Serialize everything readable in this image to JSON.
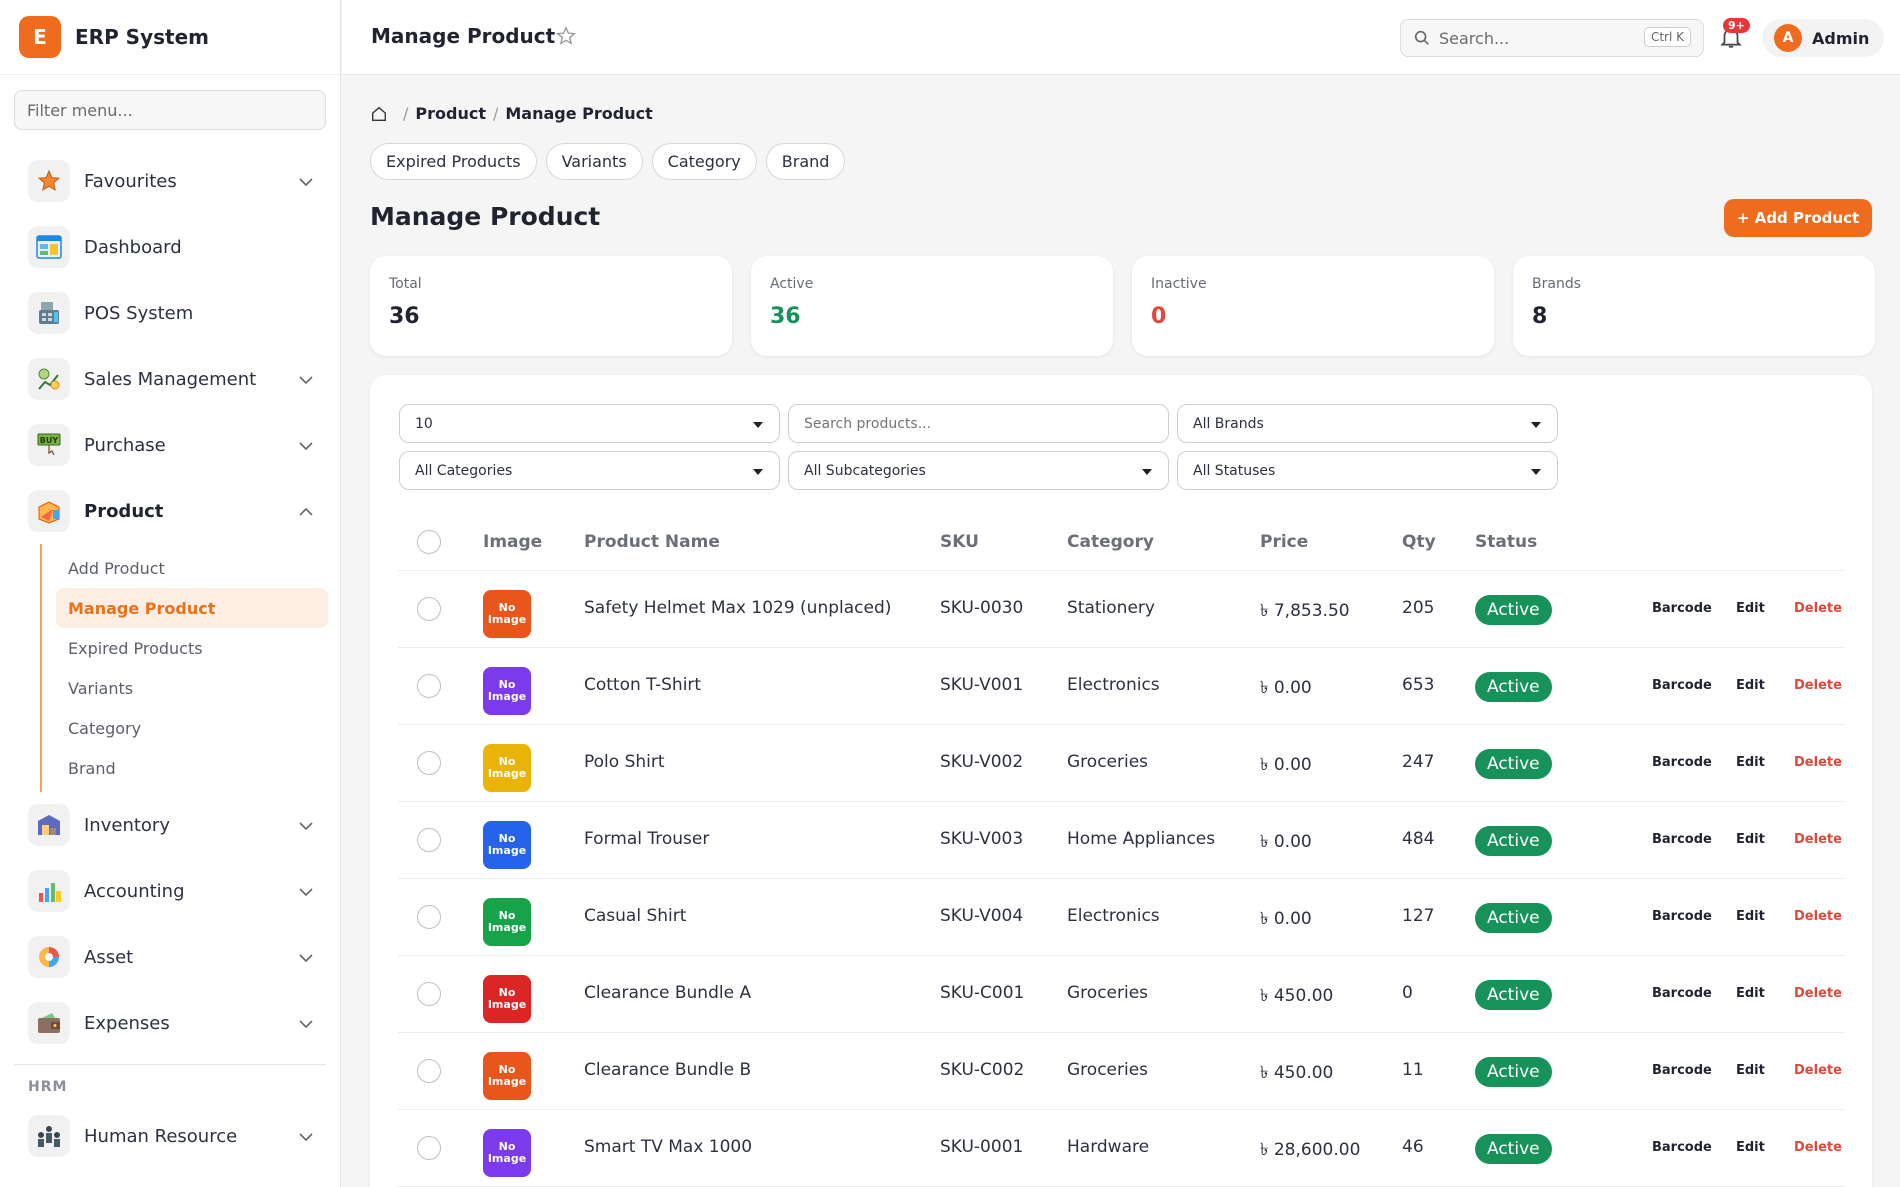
{
  "sidebar": {
    "brand_initial": "E",
    "brand_name": "ERP System",
    "filter_placeholder": "Filter menu...",
    "items_top": [
      {
        "label": "Favourites",
        "icon": "star-icon"
      },
      {
        "label": "Dashboard",
        "icon": "dashboard-icon"
      },
      {
        "label": "POS System",
        "icon": "pos-icon"
      },
      {
        "label": "Sales Management",
        "icon": "sales-icon"
      },
      {
        "label": "Purchase",
        "icon": "purchase-icon"
      },
      {
        "label": "Product",
        "icon": "product-icon"
      }
    ],
    "purchase_icon_text": "BUY",
    "product_submenu": [
      "Add Product",
      "Manage Product",
      "Expired Products",
      "Variants",
      "Category",
      "Brand"
    ],
    "items_bottom": [
      {
        "label": "Inventory",
        "icon": "inventory-icon"
      },
      {
        "label": "Accounting",
        "icon": "accounting-icon"
      },
      {
        "label": "Asset",
        "icon": "asset-icon"
      },
      {
        "label": "Expenses",
        "icon": "expenses-icon"
      }
    ],
    "section_hrm": "HRM",
    "hrm_item": "Human Resource"
  },
  "topbar": {
    "title": "Manage Product",
    "search_placeholder": "Search...",
    "shortcut": "Ctrl K",
    "notifications_badge": "9+",
    "user_initial": "A",
    "user_name": "Admin"
  },
  "breadcrumb": {
    "level1": "Product",
    "level2": "Manage Product",
    "separator": "/"
  },
  "quick_links": [
    "Expired Products",
    "Variants",
    "Category",
    "Brand"
  ],
  "page_title": "Manage Product",
  "add_button": "+ Add Product",
  "stats": [
    {
      "label": "Total",
      "value": "36",
      "color": "#1f2430"
    },
    {
      "label": "Active",
      "value": "36",
      "color": "#17925a"
    },
    {
      "label": "Inactive",
      "value": "0",
      "color": "#e0483b"
    },
    {
      "label": "Brands",
      "value": "8",
      "color": "#1f2430"
    }
  ],
  "filters": {
    "page_size": "10",
    "search_placeholder": "Search products...",
    "brand": "All Brands",
    "category": "All Categories",
    "subcategory": "All Subcategories",
    "status": "All Statuses"
  },
  "table": {
    "columns": [
      "Image",
      "Product Name",
      "SKU",
      "Category",
      "Price",
      "Qty",
      "Status"
    ],
    "no_image_text": "No Image",
    "action_labels": [
      "Barcode",
      "Edit",
      "Delete"
    ],
    "rows": [
      {
        "name": "Safety Helmet Max 1029 (unplaced)",
        "sku": "SKU-0030",
        "category": "Stationery",
        "price": "৳ 7,853.50",
        "qty": "205",
        "status": "Active",
        "img_color": "#e8561b"
      },
      {
        "name": "Cotton T-Shirt",
        "sku": "SKU-V001",
        "category": "Electronics",
        "price": "৳ 0.00",
        "qty": "653",
        "status": "Active",
        "img_color": "#7c3aed"
      },
      {
        "name": "Polo Shirt",
        "sku": "SKU-V002",
        "category": "Groceries",
        "price": "৳ 0.00",
        "qty": "247",
        "status": "Active",
        "img_color": "#eab308"
      },
      {
        "name": "Formal Trouser",
        "sku": "SKU-V003",
        "category": "Home Appliances",
        "price": "৳ 0.00",
        "qty": "484",
        "status": "Active",
        "img_color": "#2563eb"
      },
      {
        "name": "Casual Shirt",
        "sku": "SKU-V004",
        "category": "Electronics",
        "price": "৳ 0.00",
        "qty": "127",
        "status": "Active",
        "img_color": "#16a34a"
      },
      {
        "name": "Clearance Bundle A",
        "sku": "SKU-C001",
        "category": "Groceries",
        "price": "৳ 450.00",
        "qty": "0",
        "status": "Active",
        "img_color": "#dc2626"
      },
      {
        "name": "Clearance Bundle B",
        "sku": "SKU-C002",
        "category": "Groceries",
        "price": "৳ 450.00",
        "qty": "11",
        "status": "Active",
        "img_color": "#e8561b"
      },
      {
        "name": "Smart TV Max 1000",
        "sku": "SKU-0001",
        "category": "Hardware",
        "price": "৳ 28,600.00",
        "qty": "46",
        "status": "Active",
        "img_color": "#7c3aed"
      }
    ]
  }
}
